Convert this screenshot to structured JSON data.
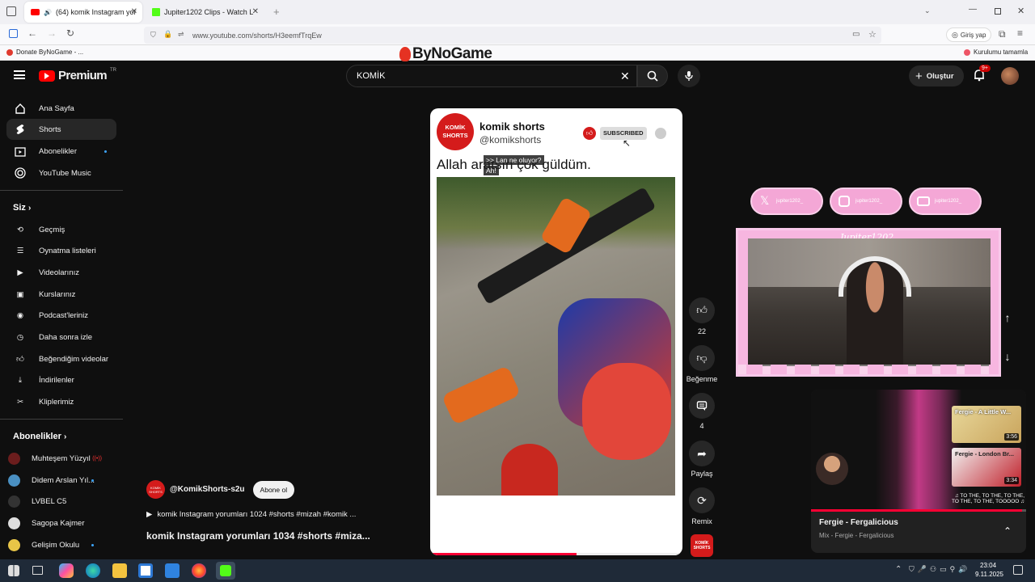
{
  "browser": {
    "tabs": [
      {
        "title": "(64) komik Instagram yorum",
        "active": true
      },
      {
        "title": "Jupiter1202 Clips - Watch Live o",
        "active": false
      }
    ],
    "url": "www.youtube.com/shorts/H3eemfTrqEw",
    "signin": "Giriş yap",
    "bookmark_left": "Donate ByNoGame - ...",
    "bookmark_right": "Kurulumu tamamla",
    "overlay_logo": "ByNoGame"
  },
  "yt_header": {
    "brand": "Premium",
    "brand_sup": "TR",
    "search_value": "KOMİK",
    "create_label": "Oluştur",
    "notif_count": "9+"
  },
  "sidebar": {
    "main": [
      {
        "label": "Ana Sayfa",
        "icon": "home-icon"
      },
      {
        "label": "Shorts",
        "icon": "shorts-icon"
      },
      {
        "label": "Abonelikler",
        "icon": "subscriptions-icon"
      },
      {
        "label": "YouTube Music",
        "icon": "music-icon"
      }
    ],
    "you_header": "Siz",
    "you": [
      {
        "label": "Geçmiş",
        "icon": "history-icon"
      },
      {
        "label": "Oynatma listeleri",
        "icon": "playlist-icon"
      },
      {
        "label": "Videolarınız",
        "icon": "your-videos-icon"
      },
      {
        "label": "Kurslarınız",
        "icon": "courses-icon"
      },
      {
        "label": "Podcast'leriniz",
        "icon": "podcast-icon"
      },
      {
        "label": "Daha sonra izle",
        "icon": "watch-later-icon"
      },
      {
        "label": "Beğendiğim videolar",
        "icon": "liked-icon"
      },
      {
        "label": "İndirilenler",
        "icon": "download-icon"
      },
      {
        "label": "Kliplerimiz",
        "icon": "clips-icon"
      }
    ],
    "subs_header": "Abonelikler",
    "subs": [
      {
        "label": "Muhteşem Yüzyıl",
        "color": "#6b1d1d"
      },
      {
        "label": "Didem Arslan Yıl...",
        "color": "#4a90c2"
      },
      {
        "label": "LVBEL C5",
        "color": "#333333"
      },
      {
        "label": "Sagopa Kajmer",
        "color": "#dddddd"
      },
      {
        "label": "Gelişim Okulu",
        "color": "#e8c547"
      }
    ]
  },
  "short": {
    "channel_name": "komik shorts",
    "channel_handle": "@komikshorts",
    "avatar_text": "KOMİK SHORTS",
    "subscribed_label": "SUBSCRIBED",
    "caption": "Allah aratsın çok güldüm.",
    "bubble1": ">> Lan ne oluyor?",
    "bubble2": "Ah!",
    "owner_handle": "@KomikShorts-s2u",
    "subscribe_label": "Abone ol",
    "description": "komik Instagram yorumları 1024 #shorts #mizah #komik ...",
    "title": "komik Instagram yorumları 1034 #shorts #miza..."
  },
  "actions": {
    "likes": "22",
    "dislike": "Beğenme",
    "comments": "4",
    "share": "Paylaş",
    "remix": "Remix"
  },
  "stream": {
    "streamer": "Jupiter1202_",
    "socials": [
      "jupiter1202_",
      "jupiter1202_",
      "jupiter1202_"
    ]
  },
  "miniplayer": {
    "title": "Fergie - Fergalicious",
    "subtitle": "Mix - Fergie - Fergalicious",
    "thumbs": [
      {
        "title": "Fergie - A Little W...",
        "duration": "3:56"
      },
      {
        "title": "Fergie - London Br...",
        "duration": "3:34"
      }
    ],
    "lyrics": "♫ TO THE, TO THE, TO THE,\nTO THE, TO THE, TOOOOO ♫",
    "progress": 0.98
  },
  "taskbar": {
    "time": "23:04",
    "date": "9.11.2025"
  }
}
